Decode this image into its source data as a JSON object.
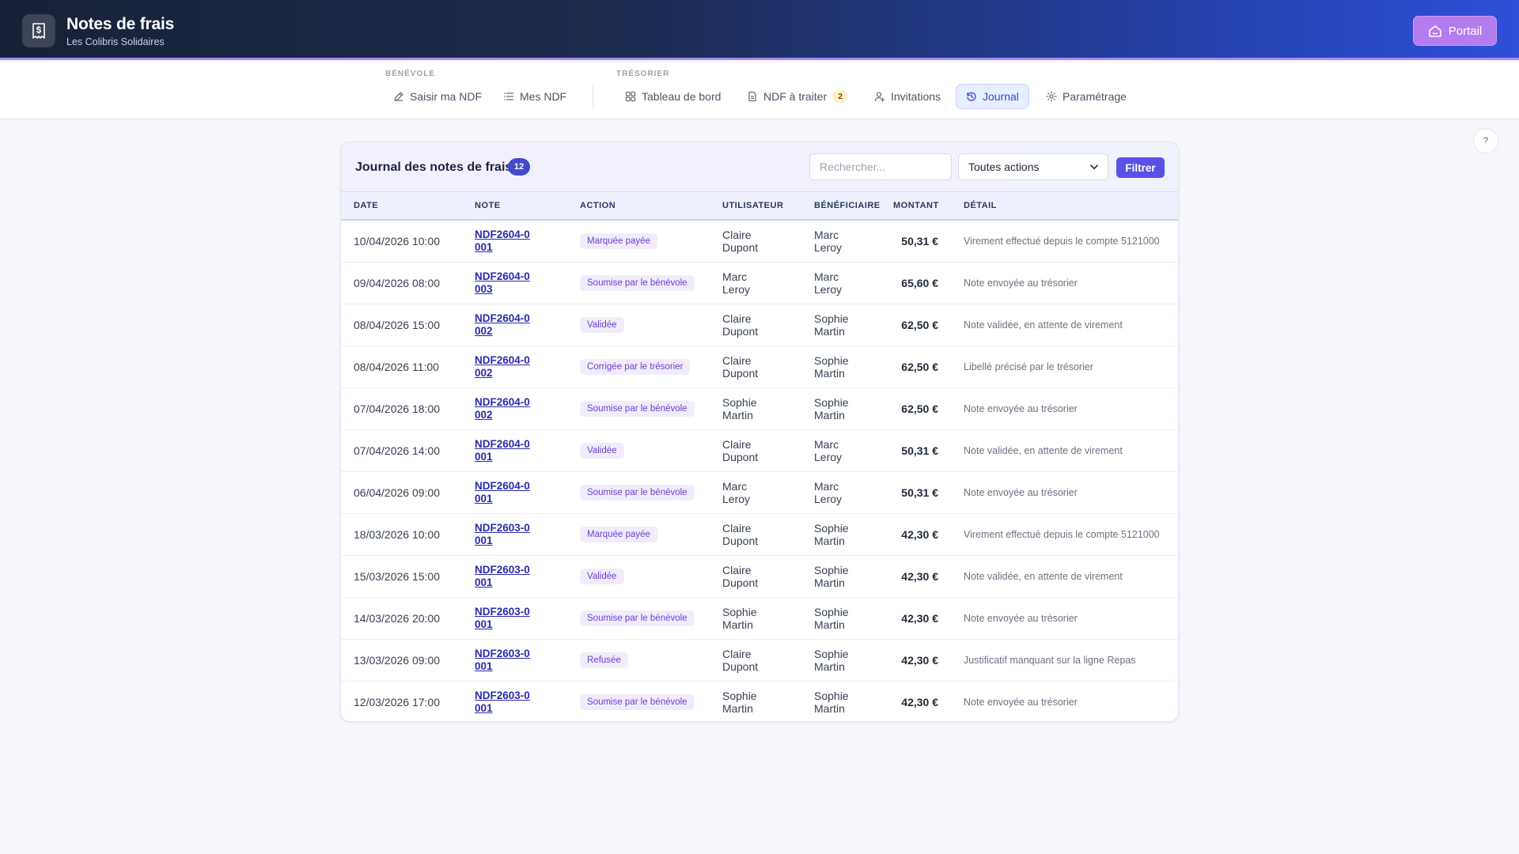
{
  "app": {
    "title": "Notes de frais",
    "subtitle": "Les Colibris Solidaires",
    "portal_label": "Portail"
  },
  "nav": {
    "benevole_label": "BÉNÉVOLE",
    "tresorier_label": "TRÉSORIER",
    "items": [
      {
        "label": "Saisir ma NDF",
        "icon": "pen-icon"
      },
      {
        "label": "Mes NDF",
        "icon": "list-icon"
      },
      {
        "label": "Tableau de bord",
        "icon": "grid-icon"
      },
      {
        "label": "NDF à traiter",
        "icon": "document-icon",
        "badge": "2"
      },
      {
        "label": "Invitations",
        "icon": "user-plus-icon"
      },
      {
        "label": "Journal",
        "icon": "history-icon",
        "active": true
      },
      {
        "label": "Paramétrage",
        "icon": "gear-icon"
      }
    ]
  },
  "help_label": "?",
  "journal": {
    "title": "Journal des notes de frais",
    "count": "12",
    "search_placeholder": "Rechercher...",
    "filter_select": "Toutes actions",
    "filter_button": "Filtrer",
    "columns": [
      "DATE",
      "NOTE",
      "ACTION",
      "UTILISATEUR",
      "BÉNÉFICIAIRE",
      "MONTANT",
      "DÉTAIL"
    ],
    "rows": [
      {
        "date": "10/04/2026 10:00",
        "note": "NDF2604-0001",
        "action": "Marquée payée",
        "user": "Claire Dupont",
        "beneficiary": "Marc Leroy",
        "amount": "50,31 €",
        "detail": "Virement effectué depuis le compte 5121000"
      },
      {
        "date": "09/04/2026 08:00",
        "note": "NDF2604-0003",
        "action": "Soumise par le bénévole",
        "user": "Marc Leroy",
        "beneficiary": "Marc Leroy",
        "amount": "65,60 €",
        "detail": "Note envoyée au trésorier"
      },
      {
        "date": "08/04/2026 15:00",
        "note": "NDF2604-0002",
        "action": "Validée",
        "user": "Claire Dupont",
        "beneficiary": "Sophie Martin",
        "amount": "62,50 €",
        "detail": "Note validée, en attente de virement"
      },
      {
        "date": "08/04/2026 11:00",
        "note": "NDF2604-0002",
        "action": "Corrigée par le trésorier",
        "user": "Claire Dupont",
        "beneficiary": "Sophie Martin",
        "amount": "62,50 €",
        "detail": "Libellé précisé par le trésorier"
      },
      {
        "date": "07/04/2026 18:00",
        "note": "NDF2604-0002",
        "action": "Soumise par le bénévole",
        "user": "Sophie Martin",
        "beneficiary": "Sophie Martin",
        "amount": "62,50 €",
        "detail": "Note envoyée au trésorier"
      },
      {
        "date": "07/04/2026 14:00",
        "note": "NDF2604-0001",
        "action": "Validée",
        "user": "Claire Dupont",
        "beneficiary": "Marc Leroy",
        "amount": "50,31 €",
        "detail": "Note validée, en attente de virement"
      },
      {
        "date": "06/04/2026 09:00",
        "note": "NDF2604-0001",
        "action": "Soumise par le bénévole",
        "user": "Marc Leroy",
        "beneficiary": "Marc Leroy",
        "amount": "50,31 €",
        "detail": "Note envoyée au trésorier"
      },
      {
        "date": "18/03/2026 10:00",
        "note": "NDF2603-0001",
        "action": "Marquée payée",
        "user": "Claire Dupont",
        "beneficiary": "Sophie Martin",
        "amount": "42,30 €",
        "detail": "Virement effectué depuis le compte 5121000"
      },
      {
        "date": "15/03/2026 15:00",
        "note": "NDF2603-0001",
        "action": "Validée",
        "user": "Claire Dupont",
        "beneficiary": "Sophie Martin",
        "amount": "42,30 €",
        "detail": "Note validée, en attente de virement"
      },
      {
        "date": "14/03/2026 20:00",
        "note": "NDF2603-0001",
        "action": "Soumise par le bénévole",
        "user": "Sophie Martin",
        "beneficiary": "Sophie Martin",
        "amount": "42,30 €",
        "detail": "Note envoyée au trésorier"
      },
      {
        "date": "13/03/2026 09:00",
        "note": "NDF2603-0001",
        "action": "Refusée",
        "user": "Claire Dupont",
        "beneficiary": "Sophie Martin",
        "amount": "42,30 €",
        "detail": "Justificatif manquant sur la ligne Repas"
      },
      {
        "date": "12/03/2026 17:00",
        "note": "NDF2603-0001",
        "action": "Soumise par le bénévole",
        "user": "Sophie Martin",
        "beneficiary": "Sophie Martin",
        "amount": "42,30 €",
        "detail": "Note envoyée au trésorier"
      }
    ]
  },
  "colors": {
    "header_start": "#172238",
    "header_end": "#2f4fd8",
    "accent": "#5b50e6",
    "link": "#2a2ab0",
    "badge_bg": "#f1ecfb",
    "badge_text": "#6d3fd2"
  }
}
